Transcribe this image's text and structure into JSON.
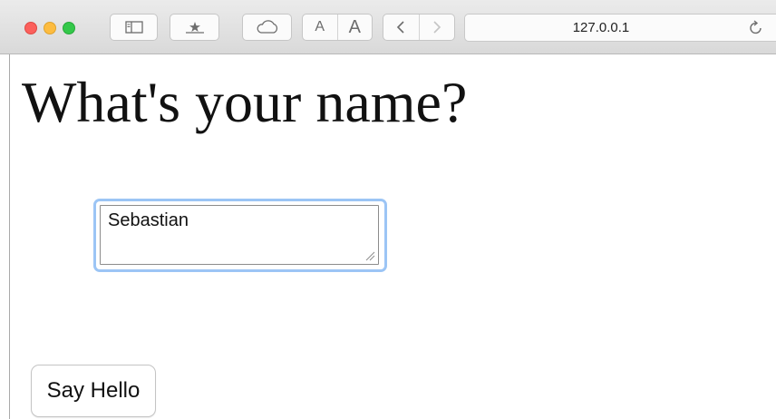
{
  "browser": {
    "url": "127.0.0.1",
    "toolbar": {
      "font_smaller_label": "A",
      "font_larger_label": "A",
      "icons": [
        "sidebar-icon",
        "bookmarks-icon",
        "cloud-icon",
        "back-icon",
        "forward-icon",
        "reload-icon"
      ]
    },
    "window_controls": [
      "close",
      "minimize",
      "zoom"
    ]
  },
  "page": {
    "title": "What's your name?",
    "name_field": {
      "value": "Sebastian",
      "focused": true
    },
    "submit_label": "Say Hello"
  },
  "colors": {
    "focus_ring": "#9cc5f5",
    "close": "#fc605c",
    "minimize": "#fdbc40",
    "zoom": "#34c84a"
  }
}
